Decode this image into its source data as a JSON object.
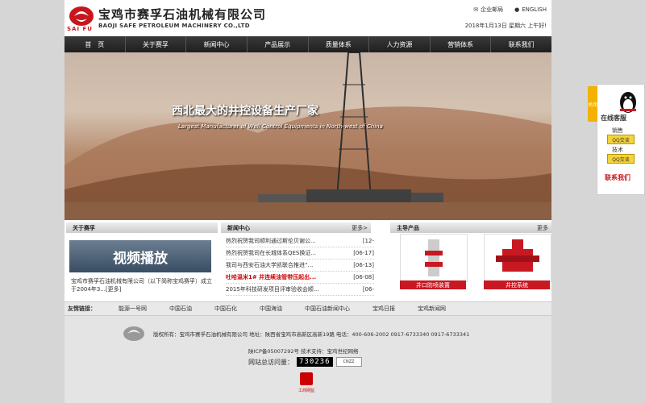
{
  "header": {
    "brand_cn": "宝鸡市赛孚石油机械有限公司",
    "brand_en": "BAOJI SAFE PETROLEUM MACHINERY CO.,LTD",
    "logo_sub": "SAI FU",
    "links": {
      "mail": "企业邮局",
      "english": "ENGLISH"
    },
    "date": "2018年1月13日  星期六 上午好!"
  },
  "nav": [
    "首　页",
    "关于赛孚",
    "新闻中心",
    "产品展示",
    "质量体系",
    "人力资源",
    "营销体系",
    "联系我们"
  ],
  "banner": {
    "title": "西北最大的井控设备生产厂家",
    "subtitle": "Largest Manufacturer of  Well Control Equipments in North-west of China"
  },
  "about": {
    "title": "关于赛孚",
    "video_label": "视频播放",
    "text": "宝鸡市赛孚石油机械有限公司（以下简称宝鸡赛孚）成立于2004年3...[更多]"
  },
  "news": {
    "title": "新闻中心",
    "more": "更多>",
    "items": [
      {
        "title": "热烈祝贺我司顺利通过斯伦贝谢公...",
        "date": "[12-",
        "red": false
      },
      {
        "title": "热烈祝贺我司在长城体系QES换证...",
        "date": "[06-17]",
        "red": false
      },
      {
        "title": "我司与西安石油大学凯联合推进“...",
        "date": "[06-13]",
        "red": false
      },
      {
        "title": "吐哈温米1# 井连续油管带压起出...",
        "date": "[06-08]",
        "red": true
      },
      {
        "title": "2015年科技研发项目评审验收会顺...",
        "date": "[06-",
        "red": false
      }
    ]
  },
  "products": {
    "title": "主导产品",
    "more": "更多",
    "items": [
      {
        "caption": "井口防喷装置"
      },
      {
        "caption": "井控系统"
      }
    ]
  },
  "links": {
    "label": "友情链接：",
    "items": [
      "能源一号网",
      "中国石油",
      "中国石化",
      "中国海油",
      "中国石油新闻中心",
      "宝鸡日报",
      "宝鸡新闻网"
    ]
  },
  "footer": {
    "copyright": "版权所有：宝鸡市赛孚石油机械有限公司  地址：陕西省宝鸡市高新区高新19路  电话：400-606-2002  0917-6733340    0917-6733341",
    "icp": "陕ICP备05007292号    技术支持：宝鸡世纪网络",
    "visits_label": "网站总访问量：",
    "visits": "730236",
    "cnzz": "CNZZ",
    "badge_label": "工商网监"
  },
  "qq": {
    "tab": "关闭",
    "title": "在线客服",
    "sales_label": "销售",
    "tech_label": "技术",
    "btn": "QQ交谈",
    "contact": "联系我们"
  }
}
